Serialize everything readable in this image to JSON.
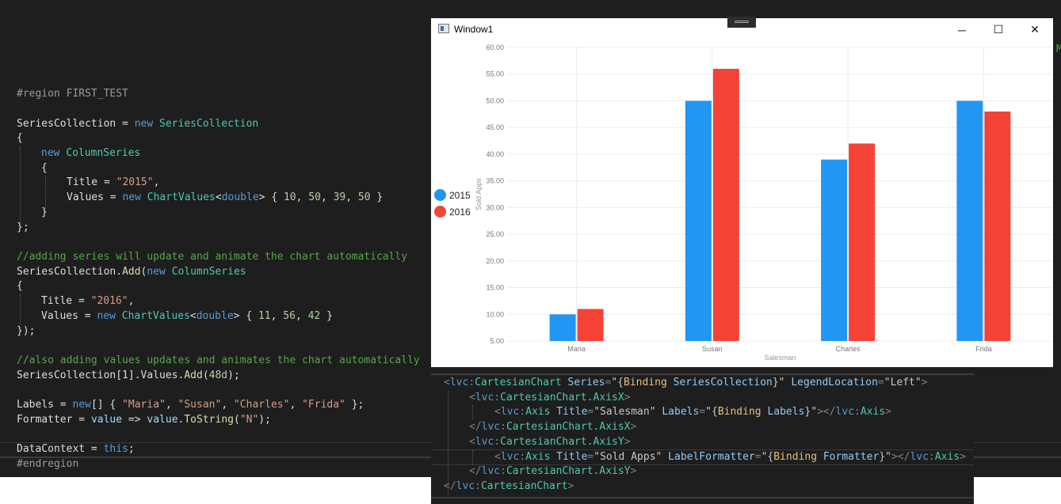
{
  "code_left": {
    "region_start": "#region FIRST_TEST",
    "region_end": "#endregion",
    "line1_var": "SeriesCollection",
    "line1_eq": " = ",
    "kw_new": "new",
    "type_series_collection": "SeriesCollection",
    "brace_open": "{",
    "brace_close_semicolon": "};",
    "brace_close": "}",
    "brace_close_paren": "});",
    "type_column_series": "ColumnSeries",
    "title_prop": "Title",
    "eq": " = ",
    "str_2015": "\"2015\"",
    "str_2016": "\"2016\"",
    "comma": ",",
    "values_prop": "Values",
    "type_chart_values": "ChartValues",
    "lt": "<",
    "gt": ">",
    "kw_double": "double",
    "values_2015_nums": [
      "10",
      "50",
      "39",
      "50"
    ],
    "values_2016_nums": [
      "11",
      "56",
      "42"
    ],
    "comment_add_series": "//adding series will update and animate the chart automatically",
    "series_add_prefix": "SeriesCollection.",
    "method_add": "Add",
    "comment_add_values": "//also adding values updates and animates the chart automatically",
    "series_index_line": "SeriesCollection[1].Values.",
    "num_48d": "48d",
    "labels_var": "Labels",
    "labels_values": [
      "\"Maria\"",
      "\"Susan\"",
      "\"Charles\"",
      "\"Frida\""
    ],
    "formatter_var": "Formatter",
    "lambda_param": "value",
    "lambda_arrow": " => ",
    "lambda_body_obj": "value",
    "method_tostring": "ToString",
    "str_n": "\"N\"",
    "datacontext_var": "DataContext",
    "kw_this": "this",
    "stray_text": "M"
  },
  "xaml": {
    "lvc": "lvc",
    "cartesian_chart": "CartesianChart",
    "attr_series": "Series",
    "val_series_binding_open": "\"{",
    "binding_kw": "Binding",
    "binding_series": "SeriesCollection",
    "val_close": "}\"",
    "attr_legend": "LegendLocation",
    "val_left": "\"Left\"",
    "axis_x_tag": "CartesianChart.AxisX",
    "axis_y_tag": "CartesianChart.AxisY",
    "axis_tag": "Axis",
    "attr_title": "Title",
    "val_salesman": "\"Salesman\"",
    "attr_labels": "Labels",
    "binding_labels": "Labels",
    "val_sold_apps": "\"Sold Apps\"",
    "attr_label_formatter": "LabelFormatter",
    "binding_formatter": "Formatter"
  },
  "window": {
    "title": "Window1",
    "minimize_glyph": "─",
    "maximize_glyph": "☐",
    "close_glyph": "✕"
  },
  "chart_data": {
    "type": "bar",
    "categories": [
      "Maria",
      "Susan",
      "Charles",
      "Frida"
    ],
    "series": [
      {
        "name": "2015",
        "values": [
          10,
          50,
          39,
          50
        ],
        "color": "#2196f3"
      },
      {
        "name": "2016",
        "values": [
          11,
          56,
          42,
          48
        ],
        "color": "#f44336"
      }
    ],
    "xlabel": "Salesman",
    "ylabel": "Sold Apps",
    "ylim": [
      5,
      60
    ],
    "yticks": [
      "5.00",
      "10.00",
      "15.00",
      "20.00",
      "25.00",
      "30.00",
      "35.00",
      "40.00",
      "45.00",
      "50.00",
      "55.00",
      "60.00"
    ],
    "legend_position": "left",
    "grid": true
  }
}
